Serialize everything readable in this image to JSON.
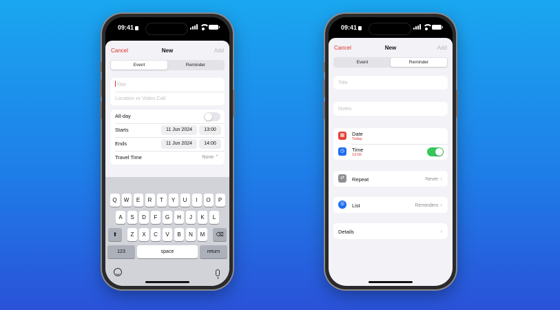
{
  "status": {
    "time": "09:41"
  },
  "left_phone": {
    "nav": {
      "cancel": "Cancel",
      "title": "New",
      "add": "Add"
    },
    "segments": [
      "Event",
      "Reminder"
    ],
    "active_segment": "Event",
    "title_placeholder": "Title",
    "location_placeholder": "Location or Video Call",
    "allday_label": "All-day",
    "allday_on": false,
    "starts_label": "Starts",
    "starts_date": "11 Jun 2024",
    "starts_time": "13:00",
    "ends_label": "Ends",
    "ends_date": "11 Jun 2024",
    "ends_time": "14:00",
    "travel_label": "Travel Time",
    "travel_value": "None",
    "keyboard": {
      "row1": [
        "Q",
        "W",
        "E",
        "R",
        "T",
        "Y",
        "U",
        "I",
        "O",
        "P"
      ],
      "row2": [
        "A",
        "S",
        "D",
        "F",
        "G",
        "H",
        "J",
        "K",
        "L"
      ],
      "row3": [
        "Z",
        "X",
        "C",
        "V",
        "B",
        "N",
        "M"
      ],
      "numbers": "123",
      "space": "space",
      "return": "return"
    }
  },
  "right_phone": {
    "nav": {
      "cancel": "Cancel",
      "title": "New",
      "add": "Add"
    },
    "segments": [
      "Event",
      "Reminder"
    ],
    "active_segment": "Reminder",
    "title_placeholder": "Title",
    "notes_placeholder": "Notes",
    "date_label": "Date",
    "date_sub": "Today",
    "time_label": "Time",
    "time_sub": "13:00",
    "time_on": true,
    "repeat_label": "Repeat",
    "repeat_value": "Never",
    "list_label": "List",
    "list_value": "Reminders",
    "details_label": "Details"
  },
  "colors": {
    "accent_red": "#e0302e",
    "toggle_green": "#34c759",
    "list_blue": "#1c6ef2",
    "calendar_red": "#e8403a",
    "repeat_gray": "#8e8e93"
  },
  "icons": [
    "calendar-icon",
    "clock-icon",
    "repeat-icon",
    "list-icon",
    "chevron-right-icon",
    "shift-icon",
    "delete-icon",
    "emoji-icon",
    "microphone-icon"
  ]
}
